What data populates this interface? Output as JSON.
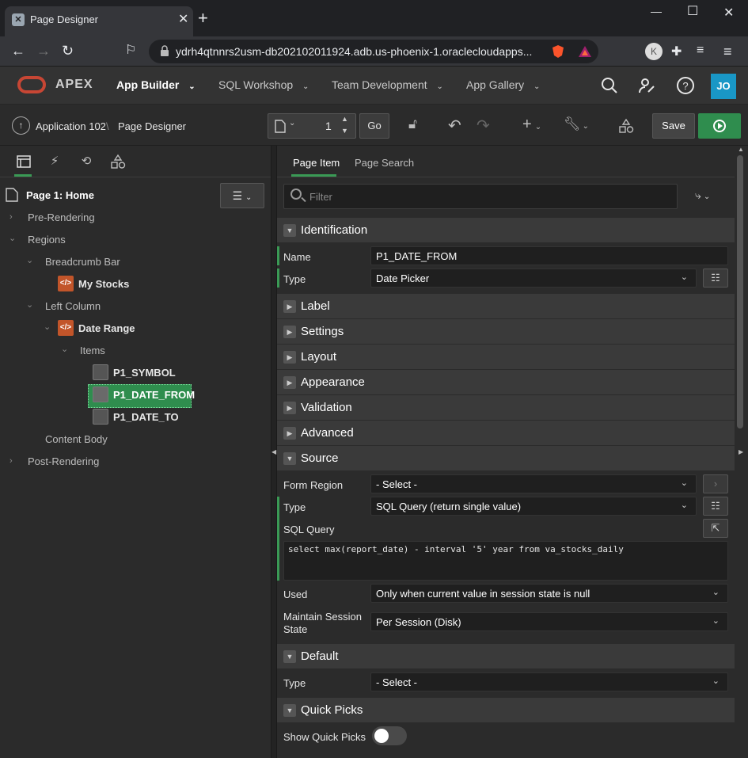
{
  "browser": {
    "tab_title": "Page Designer",
    "url": "ydrh4qtnnrs2usm-db202102011924.adb.us-phoenix-1.oraclecloudapps...."
  },
  "apex_header": {
    "brand": "APEX",
    "nav": [
      {
        "label": "App Builder"
      },
      {
        "label": "SQL Workshop"
      },
      {
        "label": "Team Development"
      },
      {
        "label": "App Gallery"
      }
    ],
    "avatar": "JO"
  },
  "toolbar": {
    "breadcrumb_app": "Application 102",
    "breadcrumb_sep": "\\",
    "breadcrumb_page": "Page Designer",
    "page_number": "1",
    "go_label": "Go",
    "save_label": "Save"
  },
  "tree": {
    "page": "Page 1: Home",
    "pre_rendering": "Pre-Rendering",
    "regions": "Regions",
    "breadcrumb_bar": "Breadcrumb Bar",
    "my_stocks": "My Stocks",
    "left_column": "Left Column",
    "date_range": "Date Range",
    "items": "Items",
    "item1": "P1_SYMBOL",
    "item2": "P1_DATE_FROM",
    "item3": "P1_DATE_TO",
    "content_body": "Content Body",
    "post_rendering": "Post-Rendering"
  },
  "props": {
    "tab_item": "Page Item",
    "tab_search": "Page Search",
    "filter_placeholder": "Filter",
    "sections": {
      "identification": "Identification",
      "label": "Label",
      "settings": "Settings",
      "layout": "Layout",
      "appearance": "Appearance",
      "validation": "Validation",
      "advanced": "Advanced",
      "source": "Source",
      "default": "Default",
      "quick_picks": "Quick Picks"
    },
    "name_label": "Name",
    "name_value": "P1_DATE_FROM",
    "type_label": "Type",
    "type_value": "Date Picker",
    "form_region_label": "Form Region",
    "form_region_value": "- Select -",
    "source_type_label": "Type",
    "source_type_value": "SQL Query (return single value)",
    "sql_query_label": "SQL Query",
    "sql_query_value": "select max(report_date) - interval '5' year from va_stocks_daily",
    "used_label": "Used",
    "used_value": "Only when current value in session state is null",
    "maintain_label": "Maintain Session State",
    "maintain_value": "Per Session (Disk)",
    "default_type_label": "Type",
    "default_type_value": "- Select -",
    "show_quick_picks_label": "Show Quick Picks"
  }
}
